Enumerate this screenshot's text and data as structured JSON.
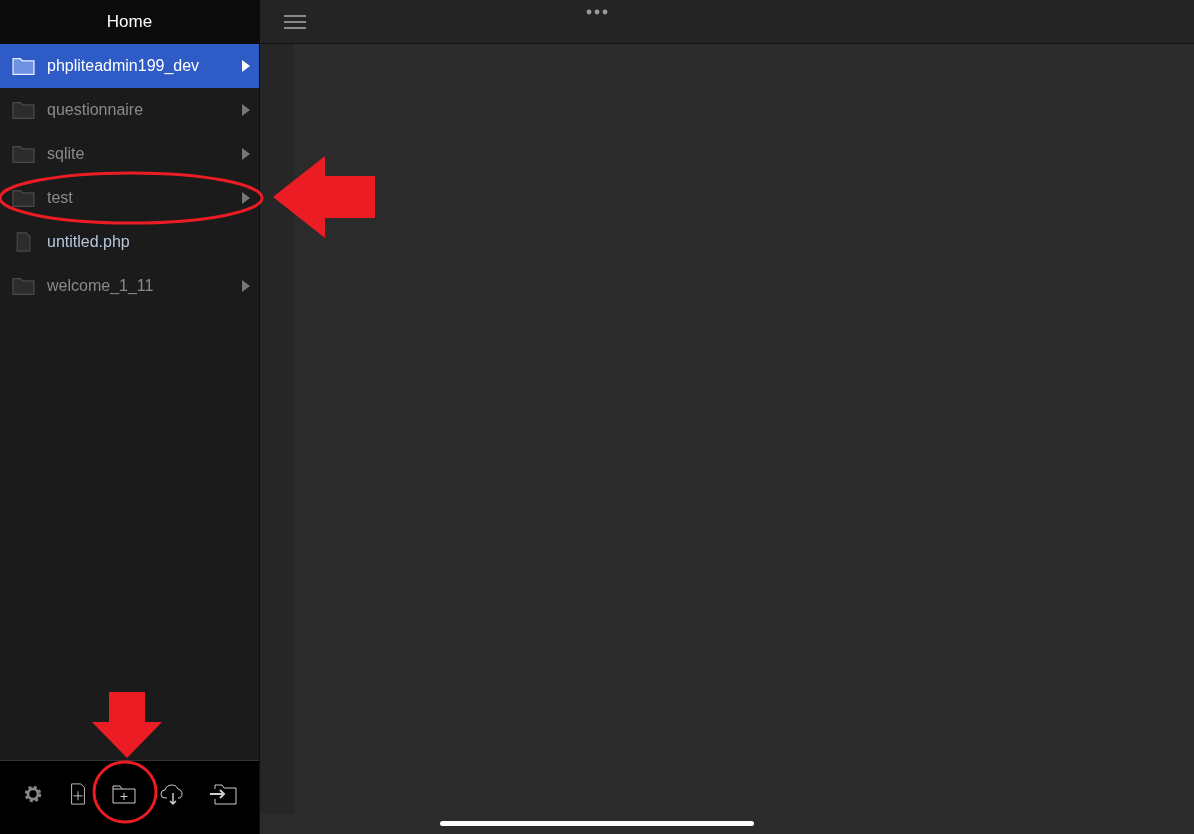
{
  "sidebar": {
    "title": "Home",
    "items": [
      {
        "kind": "folder",
        "name": "phpliteadmin199_dev",
        "selected": true
      },
      {
        "kind": "folder",
        "name": "questionnaire",
        "selected": false
      },
      {
        "kind": "folder",
        "name": "sqlite",
        "selected": false
      },
      {
        "kind": "folder",
        "name": "test",
        "selected": false
      },
      {
        "kind": "file",
        "name": "untitled.php",
        "selected": false
      },
      {
        "kind": "folder",
        "name": "welcome_1_11",
        "selected": false
      }
    ]
  }
}
